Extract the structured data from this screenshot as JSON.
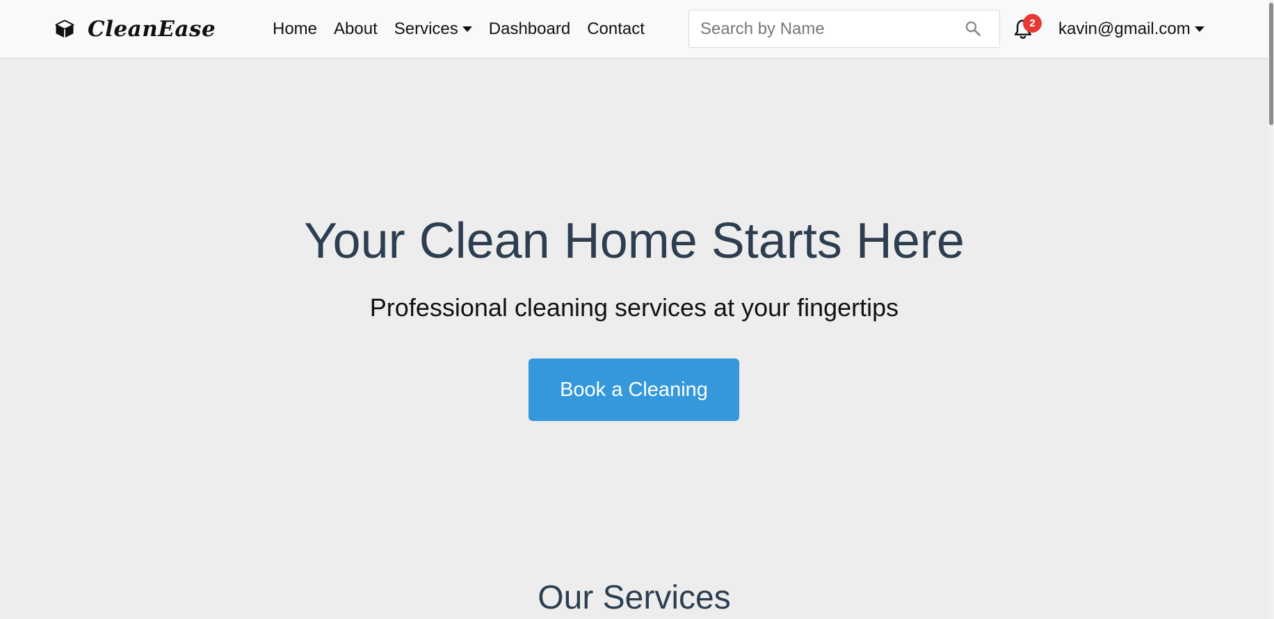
{
  "navbar": {
    "brand": "CleanEase",
    "brand_icon": "cube-icon",
    "links": [
      {
        "label": "Home"
      },
      {
        "label": "About"
      },
      {
        "label": "Services",
        "dropdown": true
      },
      {
        "label": "Dashboard"
      },
      {
        "label": "Contact"
      }
    ],
    "search": {
      "placeholder": "Search by Name",
      "value": "",
      "icon": "search-icon"
    },
    "notifications": {
      "icon": "bell-icon",
      "count": "2",
      "badge_color": "#e53935"
    },
    "user": {
      "email": "kavin@gmail.com",
      "dropdown": true
    }
  },
  "hero": {
    "title": "Your Clean Home Starts Here",
    "subtitle": "Professional cleaning services at your fingertips",
    "cta_label": "Book a Cleaning"
  },
  "services": {
    "title": "Our Services"
  },
  "colors": {
    "accent": "#3498db",
    "heading": "#2c3e50",
    "background": "#ededed",
    "navbar": "#f8f9fa"
  }
}
